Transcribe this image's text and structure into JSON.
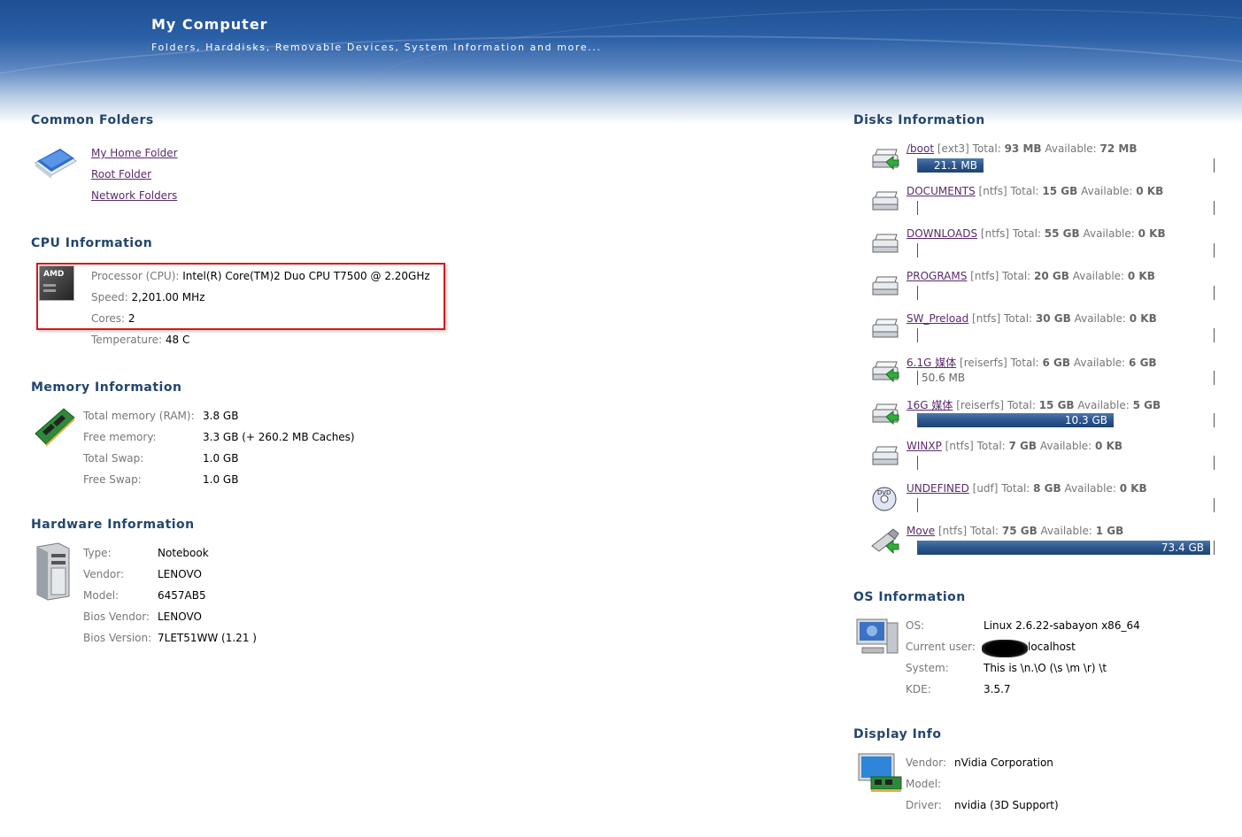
{
  "header": {
    "title": "My Computer",
    "subtitle": "Folders, Harddisks, Removable Devices, System Information and more..."
  },
  "common_folders": {
    "title": "Common Folders",
    "links": [
      "My Home Folder",
      "Root Folder",
      "Network Folders"
    ]
  },
  "cpu": {
    "title": "CPU Information",
    "icon_text": "AMD",
    "rows": [
      {
        "label": "Processor (CPU):",
        "value": "Intel(R) Core(TM)2 Duo CPU T7500 @ 2.20GHz"
      },
      {
        "label": "Speed:",
        "value": "2,201.00 MHz"
      },
      {
        "label": "Cores:",
        "value": "2"
      },
      {
        "label": "Temperature:",
        "value": "48 C"
      }
    ]
  },
  "memory": {
    "title": "Memory Information",
    "rows": [
      {
        "label": "Total memory (RAM):",
        "value": "3.8 GB"
      },
      {
        "label": "Free memory:",
        "value": "3.3 GB (+ 260.2 MB Caches)"
      },
      {
        "label": "Total Swap:",
        "value": "1.0 GB"
      },
      {
        "label": "Free Swap:",
        "value": "1.0 GB"
      }
    ]
  },
  "hardware": {
    "title": "Hardware Information",
    "rows": [
      {
        "label": "Type:",
        "value": "Notebook"
      },
      {
        "label": "Vendor:",
        "value": "LENOVO"
      },
      {
        "label": "Model:",
        "value": "6457AB5"
      },
      {
        "label": "Bios Vendor:",
        "value": "LENOVO"
      },
      {
        "label": "Bios Version:",
        "value": "7LET51WW (1.21 )"
      }
    ]
  },
  "disks": {
    "title": "Disks Information",
    "total_label": "Total:",
    "available_label": "Available:",
    "items": [
      {
        "name": "/boot",
        "fs": "[ext3]",
        "total": "93 MB",
        "available": "72 MB",
        "used_label": "21.1 MB",
        "used_fraction": 0.22,
        "icon": "hdd-mounted-icon"
      },
      {
        "name": "DOCUMENTS",
        "fs": "[ntfs]",
        "total": "15 GB",
        "available": "0 KB",
        "used_label": "",
        "used_fraction": 0,
        "icon": "hdd-icon"
      },
      {
        "name": "DOWNLOADS",
        "fs": "[ntfs]",
        "total": "55 GB",
        "available": "0 KB",
        "used_label": "",
        "used_fraction": 0,
        "icon": "hdd-icon"
      },
      {
        "name": "PROGRAMS",
        "fs": "[ntfs]",
        "total": "20 GB",
        "available": "0 KB",
        "used_label": "",
        "used_fraction": 0,
        "icon": "hdd-icon"
      },
      {
        "name": "SW_Preload",
        "fs": "[ntfs]",
        "total": "30 GB",
        "available": "0 KB",
        "used_label": "",
        "used_fraction": 0,
        "icon": "hdd-icon"
      },
      {
        "name": "6.1G 媒体",
        "fs": "[reiserfs]",
        "total": "6 GB",
        "available": "6 GB",
        "used_label": "50.6 MB",
        "used_fraction": 0.008,
        "icon": "hdd-mounted-icon"
      },
      {
        "name": "16G 媒体",
        "fs": "[reiserfs]",
        "total": "15 GB",
        "available": "5 GB",
        "used_label": "10.3 GB",
        "used_fraction": 0.66,
        "icon": "hdd-mounted-icon"
      },
      {
        "name": "WINXP",
        "fs": "[ntfs]",
        "total": "7 GB",
        "available": "0 KB",
        "used_label": "",
        "used_fraction": 0,
        "icon": "hdd-icon"
      },
      {
        "name": "UNDEFINED",
        "fs": "[udf]",
        "total": "8 GB",
        "available": "0 KB",
        "used_label": "",
        "used_fraction": 0,
        "icon": "dvd-icon"
      },
      {
        "name": "Move",
        "fs": "[ntfs]",
        "total": "75 GB",
        "available": "1 GB",
        "used_label": "73.4 GB",
        "used_fraction": 0.985,
        "icon": "usb-drive-icon"
      }
    ]
  },
  "os": {
    "title": "OS Information",
    "rows": [
      {
        "label": "OS:",
        "value": "Linux 2.6.22-sabayon x86_64"
      },
      {
        "label": "Current user:",
        "value": "localhost"
      },
      {
        "label": "System:",
        "value": "This is \\n.\\O (\\s \\m \\r) \\t"
      },
      {
        "label": "KDE:",
        "value": "3.5.7"
      }
    ]
  },
  "display": {
    "title": "Display Info",
    "rows": [
      {
        "label": "Vendor:",
        "value": "nVidia Corporation"
      },
      {
        "label": "Model:",
        "value": ""
      },
      {
        "label": "Driver:",
        "value": "nvidia (3D Support)"
      }
    ]
  }
}
